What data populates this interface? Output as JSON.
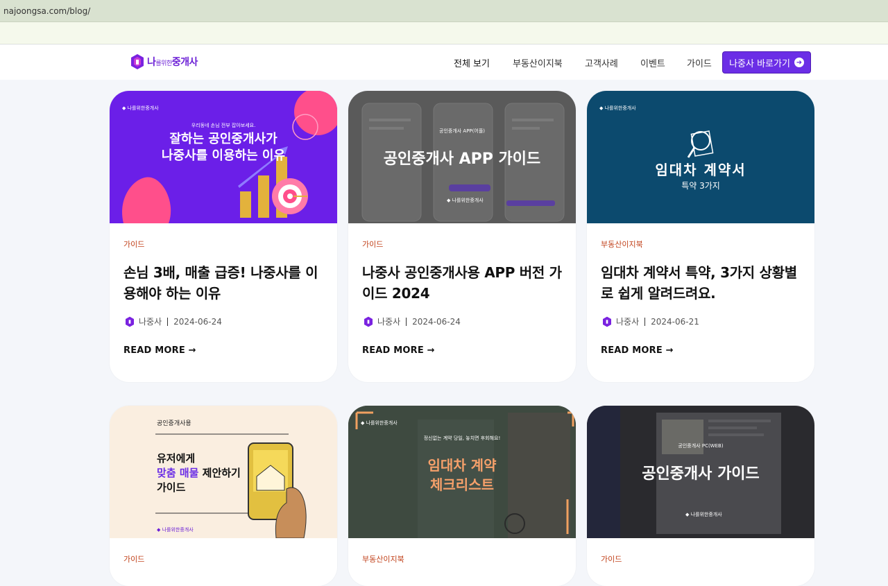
{
  "browser": {
    "url": "najoongsa.com/blog/"
  },
  "brand": {
    "logo_main": "나",
    "logo_small": "를위한",
    "logo_rest": "중개사"
  },
  "nav": {
    "items": [
      "전체 보기",
      "부동산이지북",
      "고객사례",
      "이벤트",
      "가이드"
    ],
    "cta_label": "나중사 바로가기"
  },
  "cards": [
    {
      "category": "가이드",
      "title": "손님 3배, 매출 급증! 나중사를 이용해야 하는 이유",
      "author": "나중사",
      "date": "2024-06-24",
      "more": "READ MORE →",
      "thumb": {
        "small": "우리동네 손님 전부 잡아보세요.",
        "line1": "잘하는 공인중개사가",
        "line2": "나중사를 이용하는 이유"
      }
    },
    {
      "category": "가이드",
      "title": "나중사 공인중개사용 APP 버전 가이드 2024",
      "author": "나중사",
      "date": "2024-06-24",
      "more": "READ MORE →",
      "thumb": {
        "main": "공인중개사 APP 가이드",
        "small": "공인중개사 APP(어플)"
      }
    },
    {
      "category": "부동산이지북",
      "title": "임대차 계약서 특약, 3가지 상황별로 쉽게 알려드려요.",
      "author": "나중사",
      "date": "2024-06-21",
      "more": "READ MORE →",
      "thumb": {
        "line1": "임대차 계약서",
        "line2": "특약 3가지"
      }
    },
    {
      "category": "가이드",
      "thumb": {
        "small": "공인중개사용",
        "line1": "유저에게",
        "line2_highlight": "맞춤 매물",
        "line2_rest": " 제안하기",
        "line3": "가이드"
      }
    },
    {
      "category": "부동산이지북",
      "thumb": {
        "small": "정신없는 계약 당일, 놓치면 후회해요!",
        "line1": "임대차 계약",
        "line2": "체크리스트"
      }
    },
    {
      "category": "가이드",
      "thumb": {
        "main": "공인중개사 가이드",
        "small": "공인중개사 PC(WEB)"
      }
    }
  ],
  "colors": {
    "accent": "#6b2ee6",
    "category": "#c1421b"
  }
}
